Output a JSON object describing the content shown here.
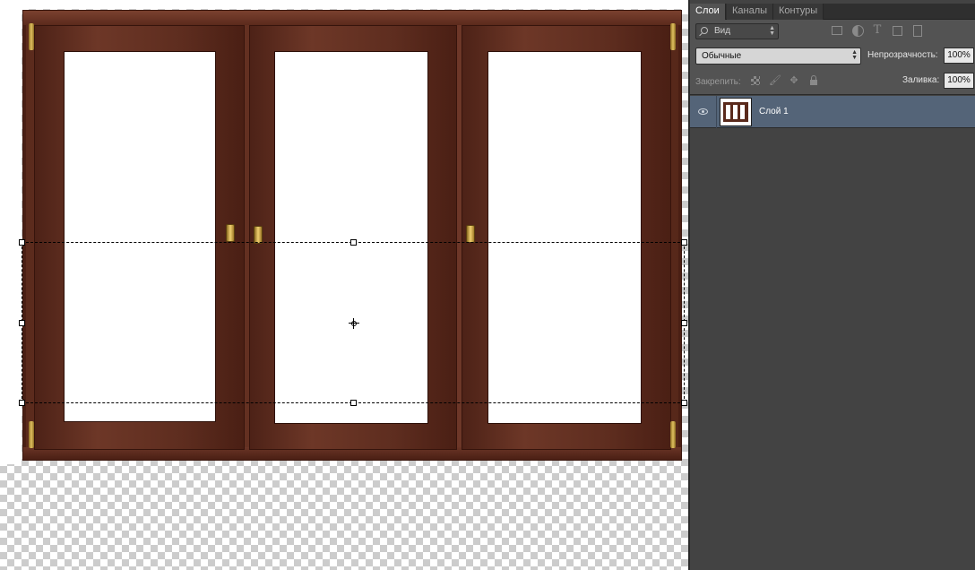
{
  "panel": {
    "tabs": [
      {
        "label": "Слои",
        "active": true
      },
      {
        "label": "Каналы",
        "active": false
      },
      {
        "label": "Контуры",
        "active": false
      }
    ],
    "filter": {
      "kind_label": "Вид",
      "icons": [
        "image-filter-icon",
        "adjustment-filter-icon",
        "type-filter-icon",
        "shape-filter-icon",
        "smart-object-filter-icon"
      ],
      "type_glyph": "T"
    },
    "blend_mode": "Обычные",
    "opacity_label": "Непрозрачность:",
    "opacity_value": "100%",
    "lock_label": "Закрепить:",
    "lock_glyphs": {
      "brush": "🖌",
      "move": "✥"
    },
    "fill_label": "Заливка:",
    "fill_value": "100%",
    "layers": [
      {
        "name": "Слой 1",
        "visible": true,
        "selected": true
      }
    ]
  },
  "canvas": {
    "content": "wooden-triple-window-image",
    "frame_color": "#5a2a1c",
    "selection": "free-transform-bounding-box"
  },
  "colors": {
    "panel_bg": "#434343",
    "toolbar_bg": "#535353",
    "selected_layer": "#546478"
  }
}
